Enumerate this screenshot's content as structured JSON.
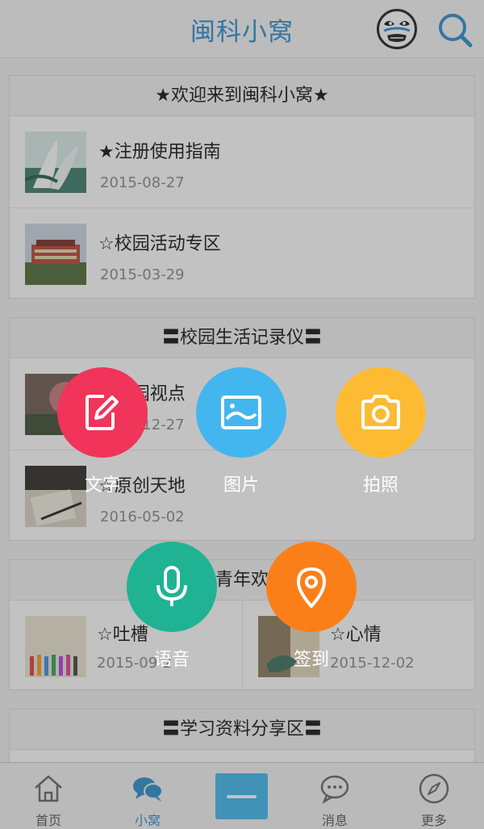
{
  "app": {
    "title": "闽科小窝"
  },
  "sections": [
    {
      "header": "★欢迎来到闽科小窝★",
      "items": [
        {
          "title": "★注册使用指南",
          "date": "2015-08-27"
        },
        {
          "title": "☆校园活动专区",
          "date": "2015-03-29"
        }
      ]
    },
    {
      "header": "〓校园生活记录仪〓",
      "items": [
        {
          "title": "☆校园视点",
          "date": "2015-12-27"
        },
        {
          "title": "☆原创天地",
          "date": "2016-05-02"
        }
      ]
    },
    {
      "header": "青年欢",
      "items": [
        {
          "title": "☆吐槽",
          "date": "2015-09-2"
        },
        {
          "title": "☆心情",
          "date": "2015-12-02"
        }
      ]
    },
    {
      "header": "〓学习资料分享区〓",
      "items": []
    }
  ],
  "actions": [
    {
      "label": "文字",
      "icon": "edit-icon",
      "color": "#f0345a"
    },
    {
      "label": "图片",
      "icon": "image-icon",
      "color": "#44b6ef"
    },
    {
      "label": "拍照",
      "icon": "camera-icon",
      "color": "#fdbb34"
    },
    {
      "label": "语音",
      "icon": "microphone-icon",
      "color": "#1fb393"
    },
    {
      "label": "签到",
      "icon": "location-pin-icon",
      "color": "#fb7f18"
    }
  ],
  "tabbar": {
    "tabs": [
      {
        "label": "首页",
        "icon": "home-icon"
      },
      {
        "label": "小窝",
        "icon": "chat-bubbles-icon",
        "active": true
      },
      {
        "label": "消息",
        "icon": "message-icon"
      },
      {
        "label": "更多",
        "icon": "compass-icon"
      }
    ],
    "center_icon": "minus-icon"
  },
  "colors": {
    "accent": "#2a8ed0",
    "center_button": "#3fb8ef"
  }
}
